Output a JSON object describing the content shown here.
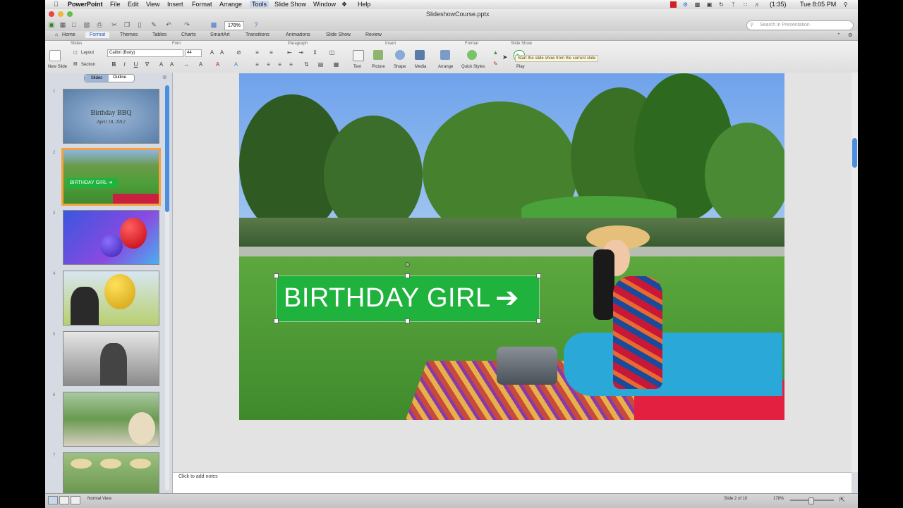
{
  "menubar": {
    "apple": "",
    "app": "PowerPoint",
    "items": [
      "File",
      "Edit",
      "View",
      "Insert",
      "Format",
      "Arrange",
      "Tools",
      "Slide Show",
      "Window",
      "Help"
    ],
    "battery": "(1:35)",
    "clock": "Tue 8:05 PM"
  },
  "window": {
    "title": "SlideshowCourse.pptx",
    "zoom": "178%",
    "search_placeholder": "Search in Presentation"
  },
  "ribbon": {
    "tabs": [
      "Home",
      "Format",
      "Themes",
      "Tables",
      "Charts",
      "SmartArt",
      "Transitions",
      "Animations",
      "Slide Show",
      "Review"
    ],
    "groups": {
      "slides": "Slides",
      "font": "Font",
      "paragraph": "Paragraph",
      "insert": "Insert",
      "format": "Format",
      "slideshow": "Slide Show"
    },
    "new_slide": "New Slide",
    "layout": "Layout",
    "section": "Section",
    "font_name": "Calibri (Body)",
    "font_size": "44",
    "insert_buttons": [
      "Text",
      "Picture",
      "Shape",
      "Media"
    ],
    "arrange": "Arrange",
    "quick_styles": "Quick Styles",
    "play": "Play",
    "tooltip": "Start the slide show from the current slide"
  },
  "sidebar": {
    "tab_slides": "Slides",
    "tab_outline": "Outline",
    "slide1_title": "Birthday BBQ",
    "slide1_date": "April 18, 2012",
    "slide2_label": "BIRTHDAY GIRL ➔",
    "numbers": [
      "1",
      "2",
      "3",
      "4",
      "5",
      "6",
      "7"
    ]
  },
  "slide": {
    "banner": "BIRTHDAY GIRL",
    "arrow": "➔",
    "colors": {
      "banner": "#1fb23c",
      "sky": "#5f9ae8",
      "grass": "#3f9a2e"
    }
  },
  "notes": {
    "placeholder": "Click to add notes"
  },
  "status": {
    "view": "Normal View",
    "slide_count": "Slide 2 of 10",
    "zoom": "178%"
  }
}
